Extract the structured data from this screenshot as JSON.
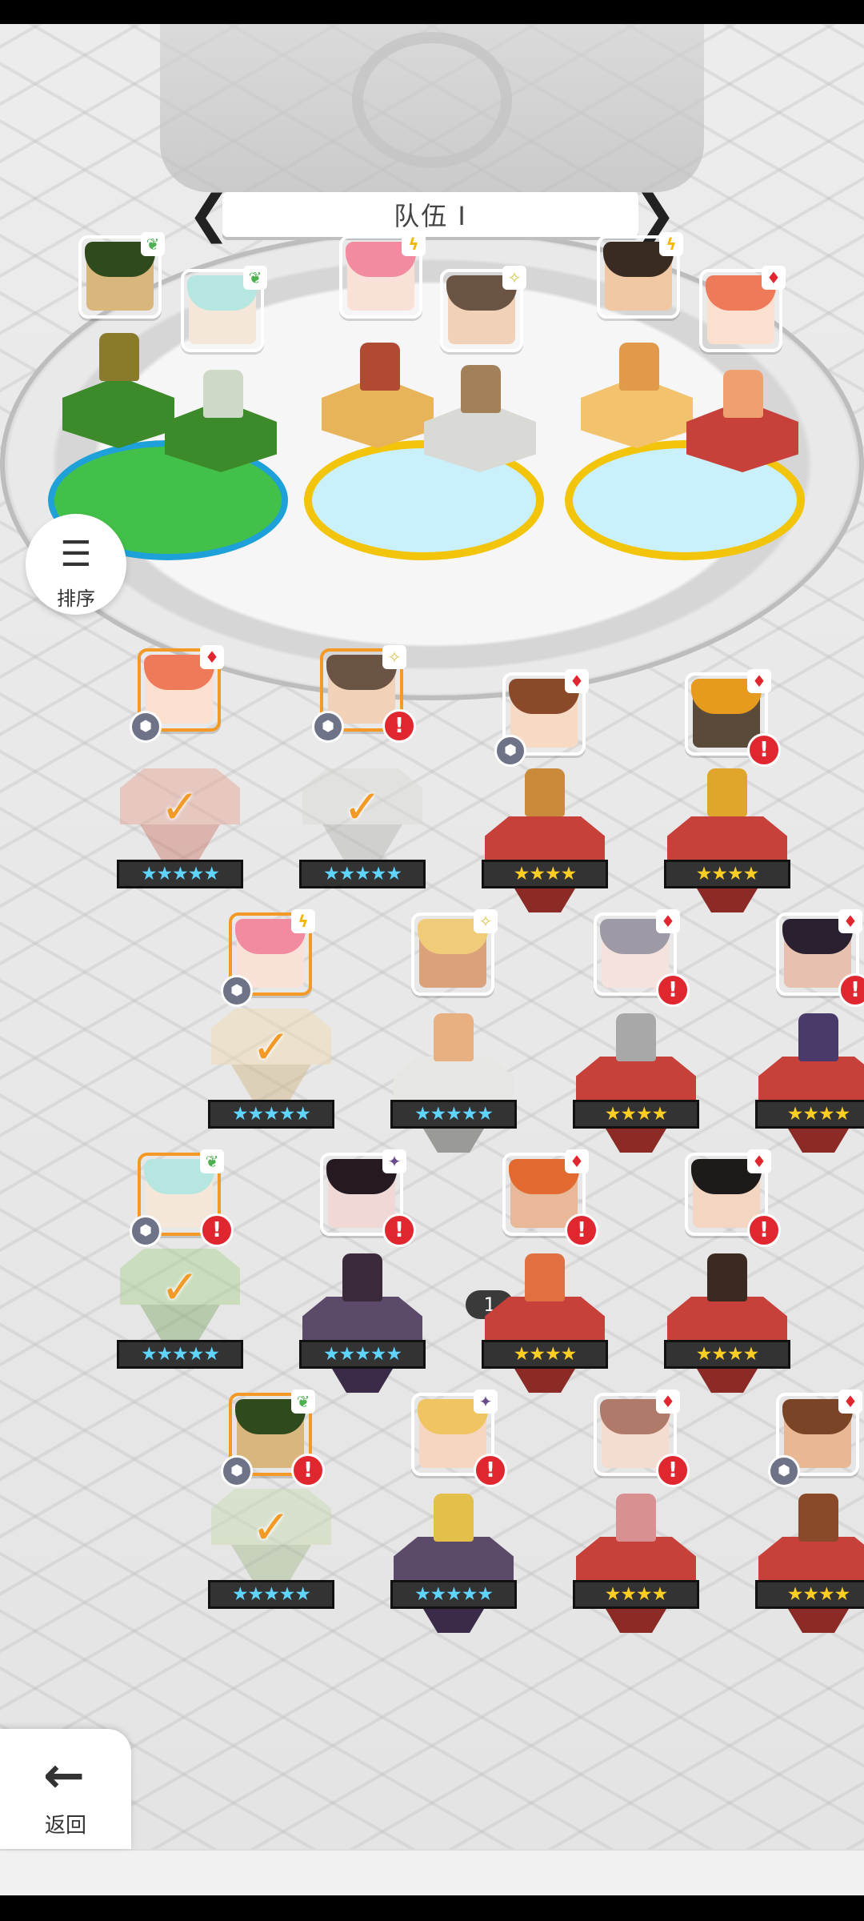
{
  "team": {
    "title": "队伍 I",
    "prev_arrow": "❮",
    "next_arrow": "❯"
  },
  "sort_button": {
    "label": "排序",
    "icon": "sort-icon",
    "glyph": "☰"
  },
  "back_button": {
    "label": "返回",
    "icon": "arrow-left-icon",
    "glyph": "←"
  },
  "elements": {
    "earth": {
      "glyph": "❦",
      "color": "#4caf50"
    },
    "lightning": {
      "glyph": "ϟ",
      "color": "#f2b705"
    },
    "fire": {
      "glyph": "♦",
      "color": "#e0262e"
    },
    "light": {
      "glyph": "✧",
      "color": "#d8c24a"
    },
    "dark": {
      "glyph": "✦",
      "color": "#6a4b8c"
    }
  },
  "stars": {
    "five": "★★★★★",
    "four": "★★★★"
  },
  "check_glyph": "✓",
  "alert_glyph": "!",
  "gem_glyph": "⬢",
  "formation": [
    {
      "element": "earth",
      "colors": [
        "#2f4a1c",
        "#d9b77c"
      ]
    },
    {
      "element": "earth",
      "colors": [
        "#b6e6e0",
        "#f4e6d8"
      ]
    },
    {
      "element": "lightning",
      "colors": [
        "#f28aa0",
        "#f9e1d8"
      ]
    },
    {
      "element": "light",
      "colors": [
        "#6b5443",
        "#f1d2b8"
      ]
    },
    {
      "element": "lightning",
      "colors": [
        "#3a2b22",
        "#f0c9a4"
      ]
    },
    {
      "element": "fire",
      "colors": [
        "#ef7a5a",
        "#fbe0d0"
      ]
    }
  ],
  "roster_badge": "1"
}
